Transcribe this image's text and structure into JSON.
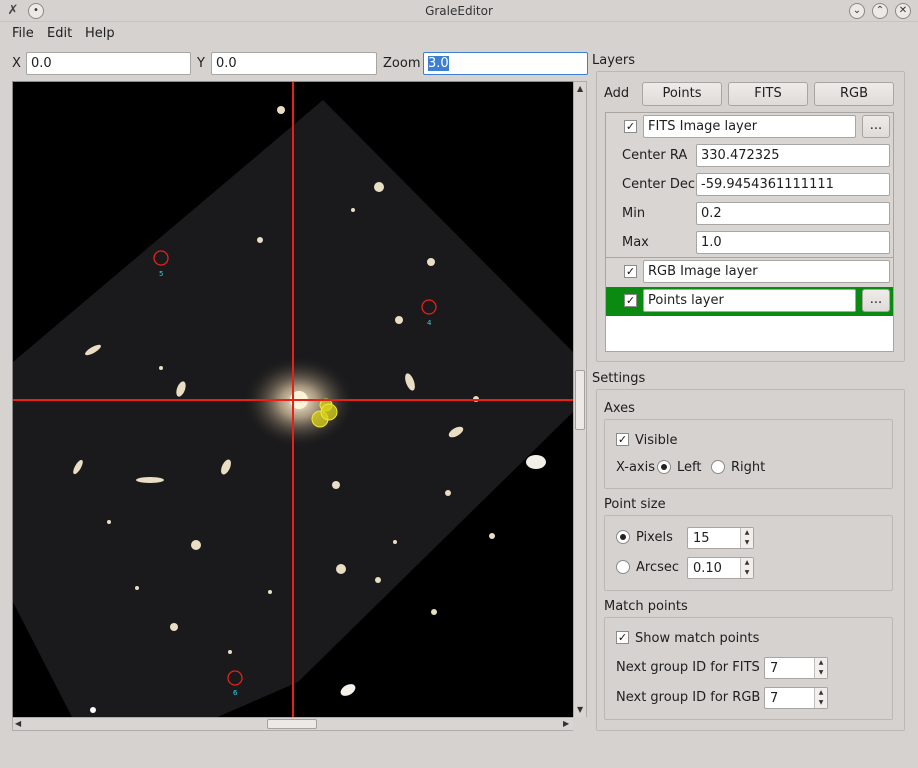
{
  "window": {
    "title": "GraleEditor"
  },
  "menu": [
    "File",
    "Edit",
    "Help"
  ],
  "coords": {
    "x_label": "X",
    "x_value": "0.0",
    "y_label": "Y",
    "y_value": "0.0",
    "zoom_label": "Zoom",
    "zoom_value": "3.0"
  },
  "viewer": {
    "crosshair_color": "#e8201a",
    "markers": [
      {
        "label": "5"
      },
      {
        "label": "4"
      },
      {
        "label": "6"
      }
    ]
  },
  "layers": {
    "title": "Layers",
    "add_label": "Add",
    "add_buttons": [
      "Points",
      "FITS",
      "RGB"
    ],
    "fits": {
      "checked": true,
      "name": "FITS Image layer",
      "more": "...",
      "props": [
        {
          "label": "Center RA",
          "value": "330.472325"
        },
        {
          "label": "Center Dec",
          "value": "-59.9454361111111"
        },
        {
          "label": "Min",
          "value": "0.2"
        },
        {
          "label": "Max",
          "value": "1.0"
        }
      ]
    },
    "rgb": {
      "checked": true,
      "name": "RGB Image layer"
    },
    "points": {
      "checked": true,
      "name": "Points layer",
      "more": "...",
      "selected_color": "#0a8a10"
    }
  },
  "settings": {
    "title": "Settings",
    "axes": {
      "title": "Axes",
      "visible_label": "Visible",
      "visible": true,
      "xaxis_label": "X-axis",
      "left_label": "Left",
      "right_label": "Right",
      "selected": "Left"
    },
    "point_size": {
      "title": "Point size",
      "pixels_label": "Pixels",
      "pixels_value": "15",
      "arcsec_label": "Arcsec",
      "arcsec_value": "0.10",
      "selected": "Pixels"
    },
    "match_points": {
      "title": "Match points",
      "show_label": "Show match points",
      "show": true,
      "fits_group_label": "Next group ID for FITS",
      "fits_group_value": "7",
      "rgb_group_label": "Next group ID for RGB",
      "rgb_group_value": "7"
    }
  }
}
